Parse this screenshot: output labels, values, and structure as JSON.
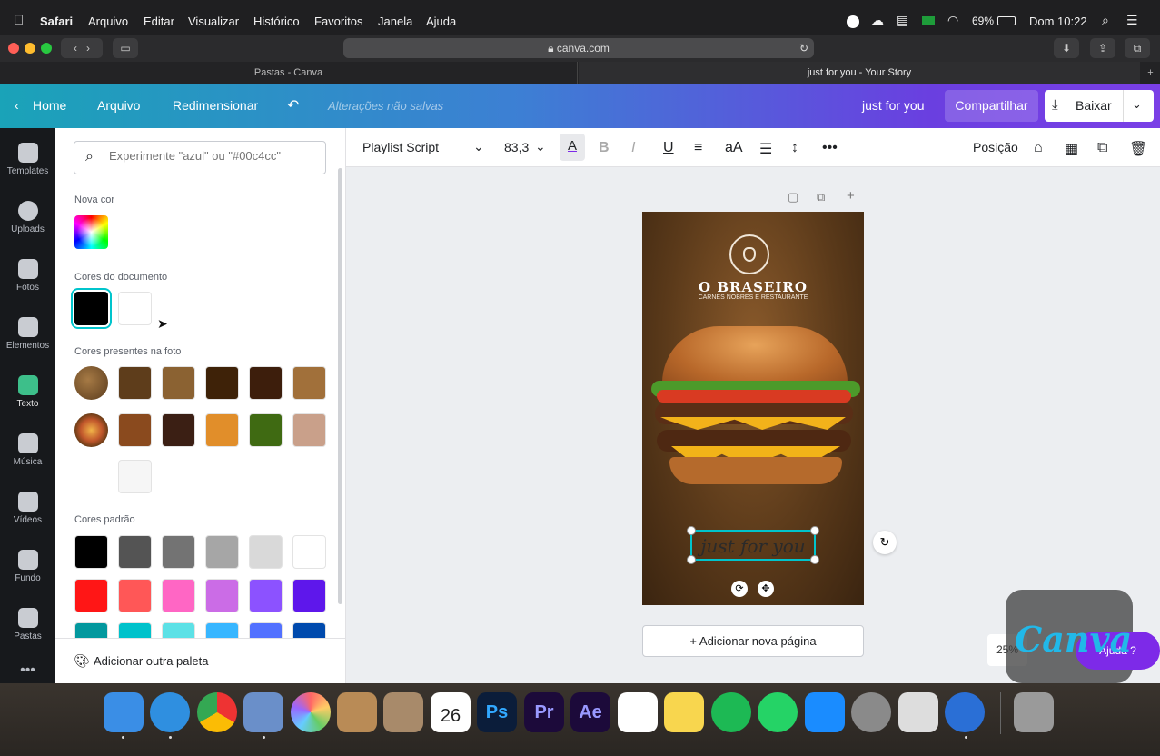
{
  "menubar": {
    "app": "Safari",
    "items": [
      "Arquivo",
      "Editar",
      "Visualizar",
      "Histórico",
      "Favoritos",
      "Janela",
      "Ajuda"
    ],
    "battery": "69%",
    "datetime": "Dom 10:22"
  },
  "browser": {
    "url": "canva.com",
    "tabs": [
      "Pastas - Canva",
      "just for you - Your Story"
    ]
  },
  "canva_header": {
    "home": "Home",
    "file": "Arquivo",
    "resize": "Redimensionar",
    "unsaved": "Alterações não salvas",
    "design_name": "just for you",
    "share": "Compartilhar",
    "download": "Baixar"
  },
  "rail": {
    "items": [
      "Templates",
      "Uploads",
      "Fotos",
      "Elementos",
      "Texto",
      "Música",
      "Vídeos",
      "Fundo",
      "Pastas"
    ]
  },
  "panel": {
    "search_placeholder": "Experimente \"azul\" ou \"#00c4cc\"",
    "new_color_label": "Nova cor",
    "document_colors_label": "Cores do documento",
    "document_colors": [
      "#000000",
      "#ffffff"
    ],
    "photo_colors_label": "Cores presentes na foto",
    "photo_colors_row1": [
      "#5e3d1b",
      "#8b6232",
      "#3e2208",
      "#3d1e0c",
      "#a1703a"
    ],
    "photo_colors_row2": [
      "#8a4a1e",
      "#3b1f14",
      "#e18e2a",
      "#3f6a12",
      "#c9a08a"
    ],
    "photo_colors_row3": [
      "#f6f6f6"
    ],
    "default_colors_label": "Cores padrão",
    "default_colors": [
      [
        "#000000",
        "#545454",
        "#737373",
        "#a6a6a6",
        "#d9d9d9",
        "#ffffff"
      ],
      [
        "#ff1616",
        "#ff5757",
        "#ff66c4",
        "#cb6ce6",
        "#8c52ff",
        "#5e17eb"
      ],
      [
        "#03989e",
        "#00c2cb",
        "#5ce1e6",
        "#38b6ff",
        "#5271ff",
        "#004aad"
      ]
    ],
    "add_palette": "Adicionar outra paleta"
  },
  "text_toolbar": {
    "font": "Playlist Script",
    "size": "83,3",
    "position": "Posição"
  },
  "design": {
    "brand": "O BRASEIRO",
    "tagline": "CARNES NOBRES E RESTAURANTE",
    "script_text": "just for you",
    "add_page": "+ Adicionar nova página"
  },
  "footer": {
    "zoom": "25%",
    "help": "Ajuda ?",
    "watermark": "Canva"
  }
}
